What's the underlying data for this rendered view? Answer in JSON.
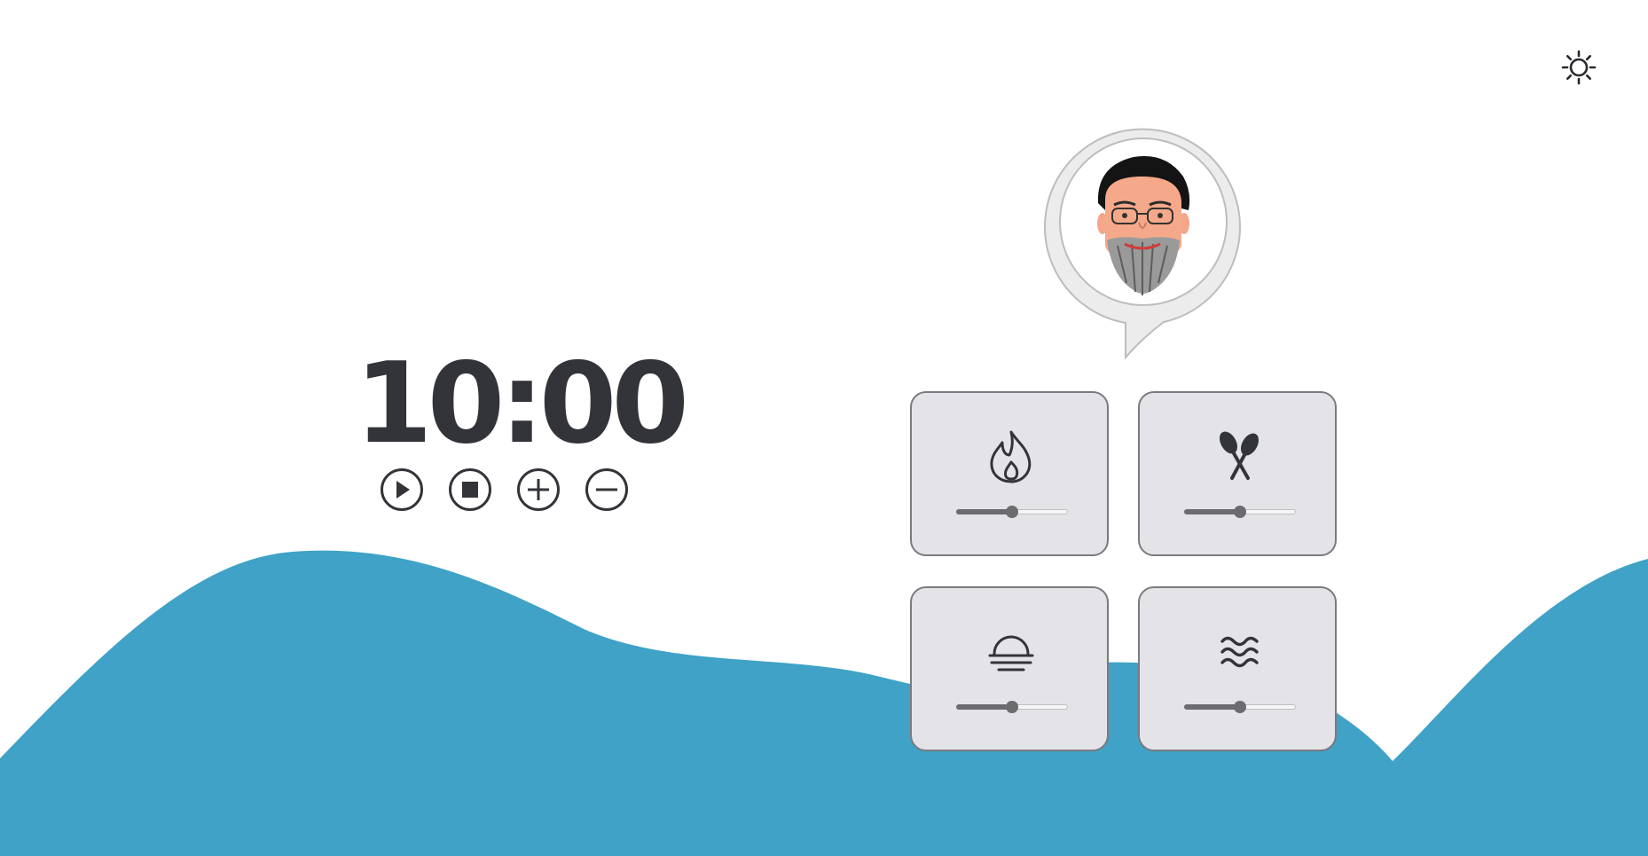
{
  "timer": {
    "display": "10:00",
    "controls": [
      {
        "name": "play-button",
        "icon": "play-icon"
      },
      {
        "name": "stop-button",
        "icon": "stop-icon"
      },
      {
        "name": "add-time-button",
        "icon": "plus-icon"
      },
      {
        "name": "subtract-time-button",
        "icon": "minus-icon"
      }
    ]
  },
  "theme_toggle": {
    "icon": "sun-icon"
  },
  "assistant": {
    "icon": "speech-bubble-avatar-icon"
  },
  "tiles": [
    {
      "name": "fire",
      "icon": "flame-icon",
      "level": 0.5
    },
    {
      "name": "maracas",
      "icon": "maracas-icon",
      "level": 0.5
    },
    {
      "name": "sunset",
      "icon": "sunset-icon",
      "level": 0.5
    },
    {
      "name": "waves",
      "icon": "waves-icon",
      "level": 0.5
    }
  ],
  "colors": {
    "wave": "#3fa2c6",
    "text": "#33343a",
    "tile_bg": "#e4e4e8",
    "tile_border": "#7a7a80",
    "slider": "#6c6c70"
  }
}
